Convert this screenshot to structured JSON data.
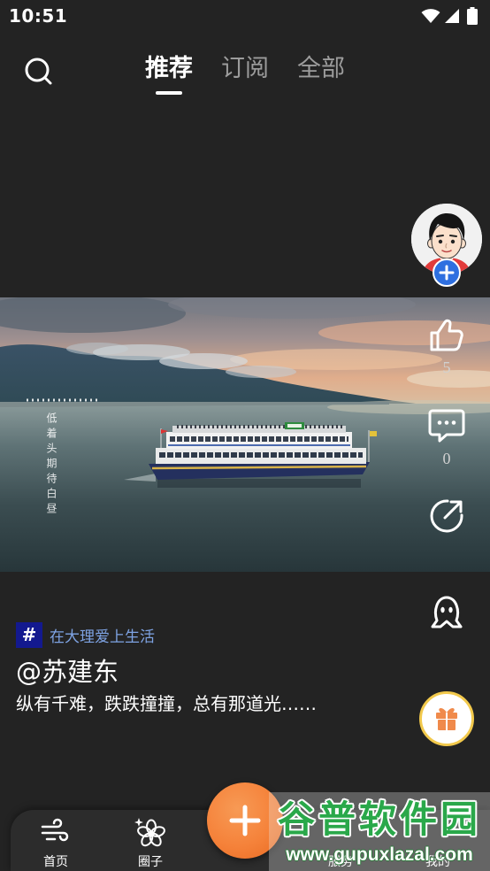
{
  "status_bar": {
    "time": "10:51",
    "icons": [
      "wifi-icon",
      "signal-icon",
      "battery-icon"
    ]
  },
  "header": {
    "search_icon": "search-icon",
    "active_tab_index": 0,
    "tabs": [
      {
        "label": "推荐"
      },
      {
        "label": "订阅"
      },
      {
        "label": "全部"
      }
    ]
  },
  "video": {
    "overlay_text": "低着头期待白昼"
  },
  "actions": {
    "avatar": "avatar-cartoon",
    "follow_icon": "plus-icon",
    "like": {
      "icon": "thumbs-up-icon",
      "count": "5"
    },
    "comment": {
      "icon": "comment-icon",
      "count": "0"
    },
    "share": {
      "icon": "share-icon"
    },
    "character": {
      "icon": "character-icon"
    },
    "gift": {
      "icon": "gift-icon"
    }
  },
  "post": {
    "topic_badge": "#",
    "topic": "在大理爱上生活",
    "author": "@苏建东",
    "caption": "纵有千难，跌跌撞撞，总有那道光……"
  },
  "bottom_nav": {
    "items": [
      {
        "label": "首页",
        "icon": "wind-icon"
      },
      {
        "label": "圈子",
        "icon": "flower-icon"
      },
      {
        "label": "服务"
      },
      {
        "label": "我的"
      }
    ],
    "center_button": {
      "icon": "plus-icon"
    }
  },
  "watermark": {
    "title": "谷普软件园",
    "url": "www.gupuxlazal.com"
  },
  "colors": {
    "background": "#232323",
    "accent": "#f5823a",
    "topic": "#7ea3e3",
    "badge": "#13198f",
    "follow": "#2e6fe0",
    "gift_ring": "#f2c94c",
    "gift": "#f08a4b"
  }
}
